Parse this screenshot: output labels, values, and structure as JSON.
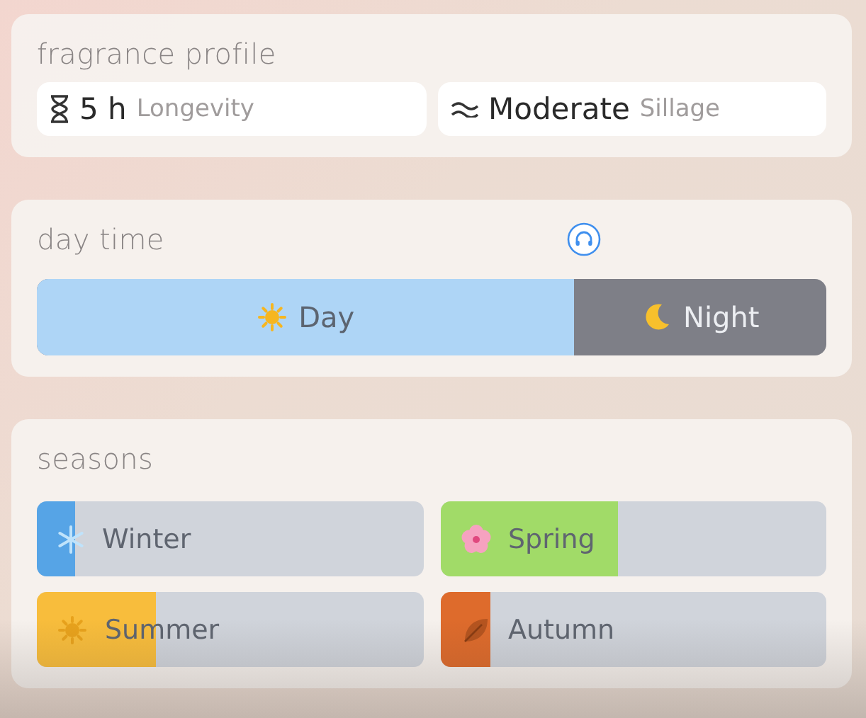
{
  "profile": {
    "title": "fragrance profile",
    "stats": [
      {
        "kind": "longevity",
        "value": "5 h",
        "label": "Longevity"
      },
      {
        "kind": "sillage",
        "value": "Moderate",
        "label": "Sillage"
      }
    ]
  },
  "day_time": {
    "title": "day time",
    "bar": {
      "level": 0.68
    },
    "segments": [
      {
        "kind": "day",
        "label": "Day"
      },
      {
        "kind": "night",
        "label": "Night"
      }
    ]
  },
  "seasons": {
    "title": "seasons",
    "items": [
      {
        "kind": "winter",
        "label": "Winter",
        "level": 0.1,
        "color": "#56a4e6"
      },
      {
        "kind": "spring",
        "label": "Spring",
        "level": 0.46,
        "color": "#a1db68"
      },
      {
        "kind": "summer",
        "label": "Summer",
        "level": 0.31,
        "color": "#f8bd3c"
      },
      {
        "kind": "autumn",
        "label": "Autumn",
        "level": 0.13,
        "color": "#de6b2c"
      }
    ]
  }
}
